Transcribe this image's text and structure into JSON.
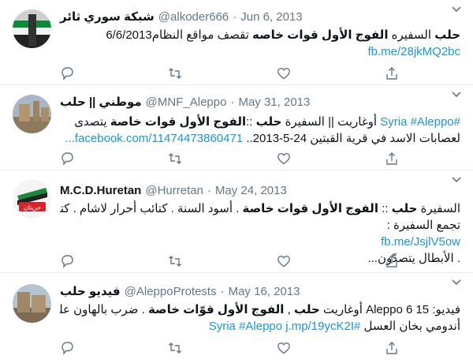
{
  "tweets": [
    {
      "name": "شبكة سوري ثائر",
      "handle": "@alkoder666",
      "date": "Jun 6, 2013",
      "lines": [
        {
          "pre": "",
          "bold1": "حلب",
          "mid": " السفيره ",
          "bold2": "الفوج الأول قوات خاصه",
          "post": " تقصف مواقع النظام6/6/2013"
        },
        {
          "link": "fb.me/28jkMQ2bc"
        }
      ]
    },
    {
      "name": "موطني || حلب",
      "handle": "@MNF_Aleppo",
      "date": "May 31, 2013",
      "lines": [
        {
          "tags": "#Syria #Aleppo",
          "pre": " أوغاريت || السفيرة ",
          "bold1": "حلب",
          "mid": " ::",
          "bold2": "الفوج الأول قوات خاصة",
          "post": " يتصدى"
        },
        {
          "text": "لعصابات الاسد في قرية القبتين 24-5-2013..",
          "link": "facebook.com/11474473860471..."
        }
      ]
    },
    {
      "name": "M.C.D.Huretan",
      "handle": "@Hurretan",
      "date": "May 24, 2013",
      "avatar_text": "حريتان",
      "lines": [
        {
          "pre": "السفيرة ",
          "bold1": "حلب",
          "mid": " :: ",
          "bold2": "الفوج الأول قوات خاصة",
          "post": " . أسود السنة . كتائب أحرار لاشام . كتائب"
        },
        {
          "text": "تجمع السفيرة :"
        },
        {
          "link": "fb.me/JsjlV5ow"
        },
        {
          "text": ". الأبطال يتصدّون..."
        }
      ]
    },
    {
      "name": "فيديو حلب",
      "handle": "@AleppoProtests",
      "date": "May 16, 2013",
      "lines": [
        {
          "pre": "فيديو: Aleppo 6 15 أوغاريت ",
          "bold1": "حلب",
          "mid": " , ",
          "bold2": "الفوج الأول قوّات خاصة",
          "post": " . ضرب بالهاون على"
        },
        {
          "text": "أندومي بخان العسل ",
          "tags": "#Syria #Aleppo j.mp/19ycK2I"
        }
      ]
    }
  ],
  "icons": [
    "reply-icon",
    "retweet-icon",
    "like-icon",
    "share-icon",
    "chevron-down-icon"
  ],
  "colors": {
    "link": "#1b95e0",
    "muted": "#657786",
    "text": "#0f1419",
    "border": "#e6ecf0"
  }
}
